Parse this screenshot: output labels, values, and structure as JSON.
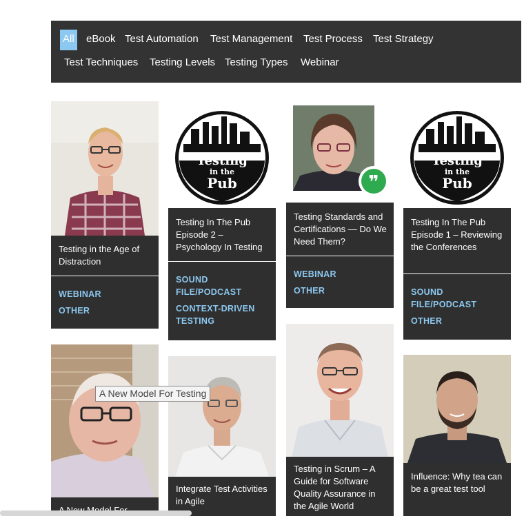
{
  "filters": [
    "All",
    "eBook",
    "Test Automation",
    "Test Management",
    "Test Process",
    "Test Strategy",
    "Test Techniques",
    "Testing Levels",
    "Testing Types",
    "Webinar"
  ],
  "colors": {
    "bar": "#333333",
    "accent": "#8cc8f0",
    "card": "#2f2f2f"
  },
  "cards": [
    {
      "title": "Testing in the Age of Distraction",
      "tags": [
        "Webinar",
        "Other"
      ]
    },
    {
      "title": "Testing In The Pub Episode 2 – Psychology In Testing",
      "tags": [
        "Sound File/Podcast",
        "Context-Driven Testing"
      ]
    },
    {
      "title": "Testing Standards and Certifications — Do We Need Them?",
      "tags": [
        "Webinar",
        "Other"
      ]
    },
    {
      "title": "Testing In The Pub Episode 1 – Reviewing the Conferences",
      "tags": [
        "Sound File/Podcast",
        "Other"
      ]
    },
    {
      "title": "A New Model For Testing"
    },
    {
      "title": "Integrate Test Activities in Agile"
    },
    {
      "title": "Testing in Scrum – A Guide for Software Quality Assurance in the Agile World"
    },
    {
      "title": "Influence: Why tea can be a great test tool"
    }
  ],
  "logo": {
    "line1": "Testing",
    "line2": "in the",
    "line3": "Pub"
  },
  "tooltip": "A New Model For Testing",
  "icons": [
    "quote-icon"
  ]
}
